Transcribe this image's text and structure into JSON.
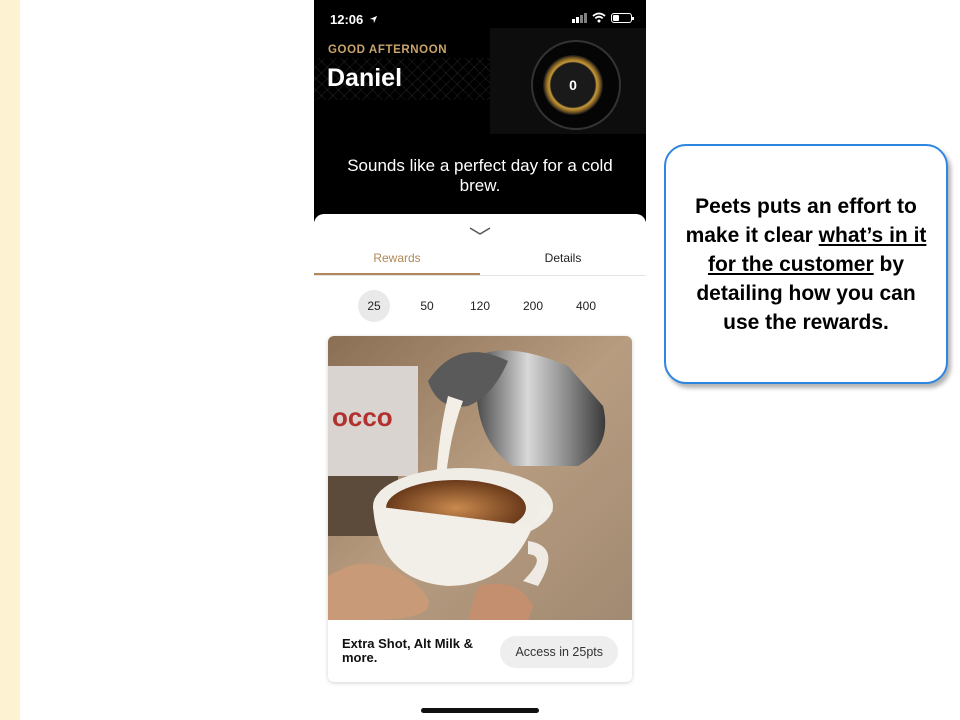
{
  "status_bar": {
    "time": "12:06"
  },
  "header": {
    "greeting": "GOOD AFTERNOON",
    "user_name": "Daniel",
    "points": "0",
    "message": "Sounds like a perfect day for a cold brew."
  },
  "tabs": [
    {
      "label": "Rewards",
      "active": true
    },
    {
      "label": "Details",
      "active": false
    }
  ],
  "tiers": [
    {
      "label": "25",
      "active": true
    },
    {
      "label": "50",
      "active": false
    },
    {
      "label": "120",
      "active": false
    },
    {
      "label": "200",
      "active": false
    },
    {
      "label": "400",
      "active": false
    }
  ],
  "reward_card": {
    "title": "Extra Shot, Alt Milk & more.",
    "button_label": "Access in 25pts",
    "machine_text": "occo"
  },
  "callout": {
    "part1": "Peets puts an effort to make it clear ",
    "part2_underlined": "what’s in it for the customer",
    "part3": " by detailing how you can use the rewards."
  },
  "colors": {
    "accent_gold": "#b0885a",
    "greeting_gold": "#c9a46b",
    "callout_border": "#2f86e0",
    "stripe": "#fdf3d2"
  },
  "icons": [
    "location-arrow-icon",
    "signal-icon",
    "wifi-icon",
    "battery-icon",
    "chevron-down-icon"
  ]
}
